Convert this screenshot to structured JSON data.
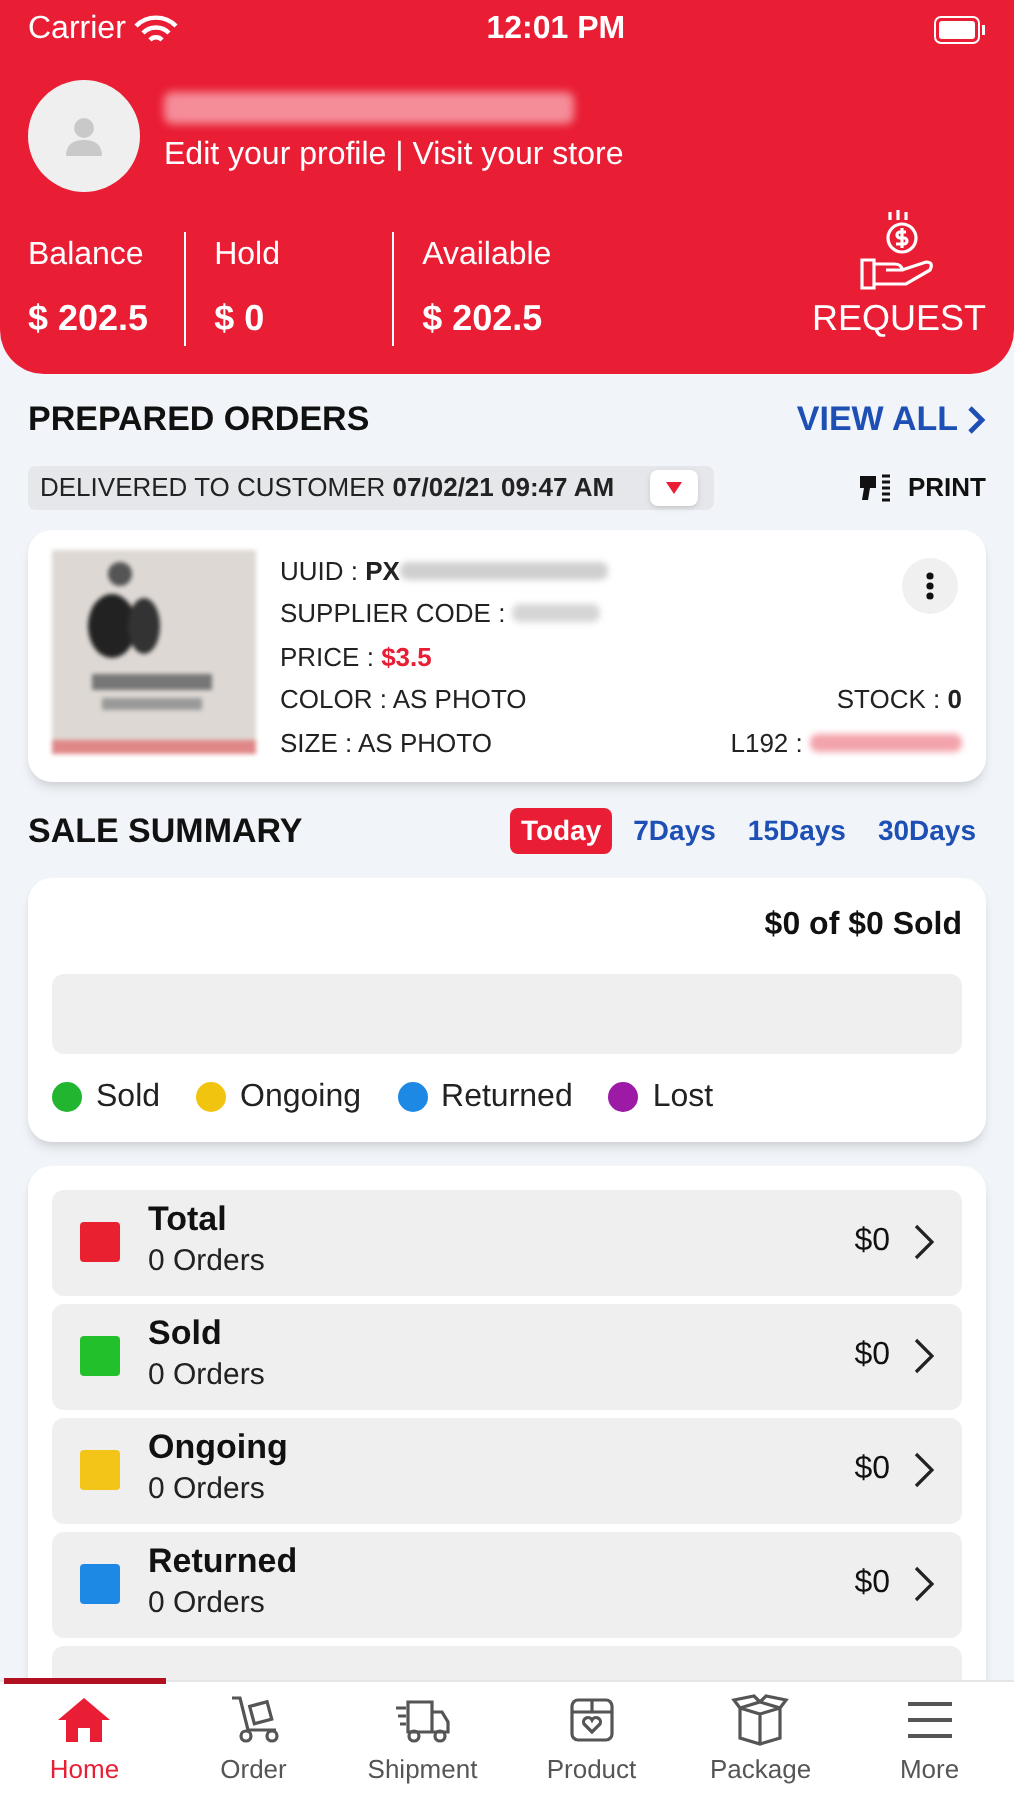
{
  "status_bar": {
    "carrier": "Carrier",
    "time": "12:01 PM"
  },
  "header": {
    "profile_links": "Edit your profile | Visit your store",
    "balances": [
      {
        "label": "Balance",
        "value": "$ 202.5"
      },
      {
        "label": "Hold",
        "value": "$ 0"
      },
      {
        "label": "Available",
        "value": "$ 202.5"
      }
    ],
    "request": "REQUEST"
  },
  "prepared_orders": {
    "title": "PREPARED ORDERS",
    "view_all": "VIEW ALL",
    "filter": {
      "status": "DELIVERED TO CUSTOMER",
      "date": "07/02/21 09:47 AM"
    },
    "print": "PRINT",
    "order": {
      "uuid_label": "UUID : ",
      "uuid_prefix": "PX",
      "supplier_label": "SUPPLIER CODE : ",
      "price_label": "PRICE : ",
      "price": "$3.5",
      "color_text": "COLOR : AS PHOTO",
      "size_text": "SIZE : AS PHOTO",
      "stock_label": "STOCK : ",
      "stock": "0",
      "code_label": "L192 : "
    }
  },
  "sale_summary": {
    "title": "SALE SUMMARY",
    "ranges": [
      {
        "label": "Today",
        "selected": true
      },
      {
        "label": "7Days",
        "selected": false
      },
      {
        "label": "15Days",
        "selected": false
      },
      {
        "label": "30Days",
        "selected": false
      }
    ],
    "sold_total": "$0 of $0 Sold",
    "legend": [
      {
        "label": "Sold",
        "color": "#22b530"
      },
      {
        "label": "Ongoing",
        "color": "#f1c40f"
      },
      {
        "label": "Returned",
        "color": "#1e88e5"
      },
      {
        "label": "Lost",
        "color": "#9c1aa6"
      }
    ],
    "stats": [
      {
        "label": "Total",
        "orders": "0 Orders",
        "amount": "$0",
        "color": "#e8202f"
      },
      {
        "label": "Sold",
        "orders": "0 Orders",
        "amount": "$0",
        "color": "#22c02b"
      },
      {
        "label": "Ongoing",
        "orders": "0 Orders",
        "amount": "$0",
        "color": "#f2c518"
      },
      {
        "label": "Returned",
        "orders": "0 Orders",
        "amount": "$0",
        "color": "#1e88e5"
      }
    ]
  },
  "tab_bar": [
    {
      "label": "Home",
      "kind": "home",
      "selected": true
    },
    {
      "label": "Order",
      "kind": "order",
      "selected": false
    },
    {
      "label": "Shipment",
      "kind": "shipment",
      "selected": false
    },
    {
      "label": "Product",
      "kind": "product",
      "selected": false
    },
    {
      "label": "Package",
      "kind": "package",
      "selected": false
    },
    {
      "label": "More",
      "kind": "more",
      "selected": false
    }
  ]
}
